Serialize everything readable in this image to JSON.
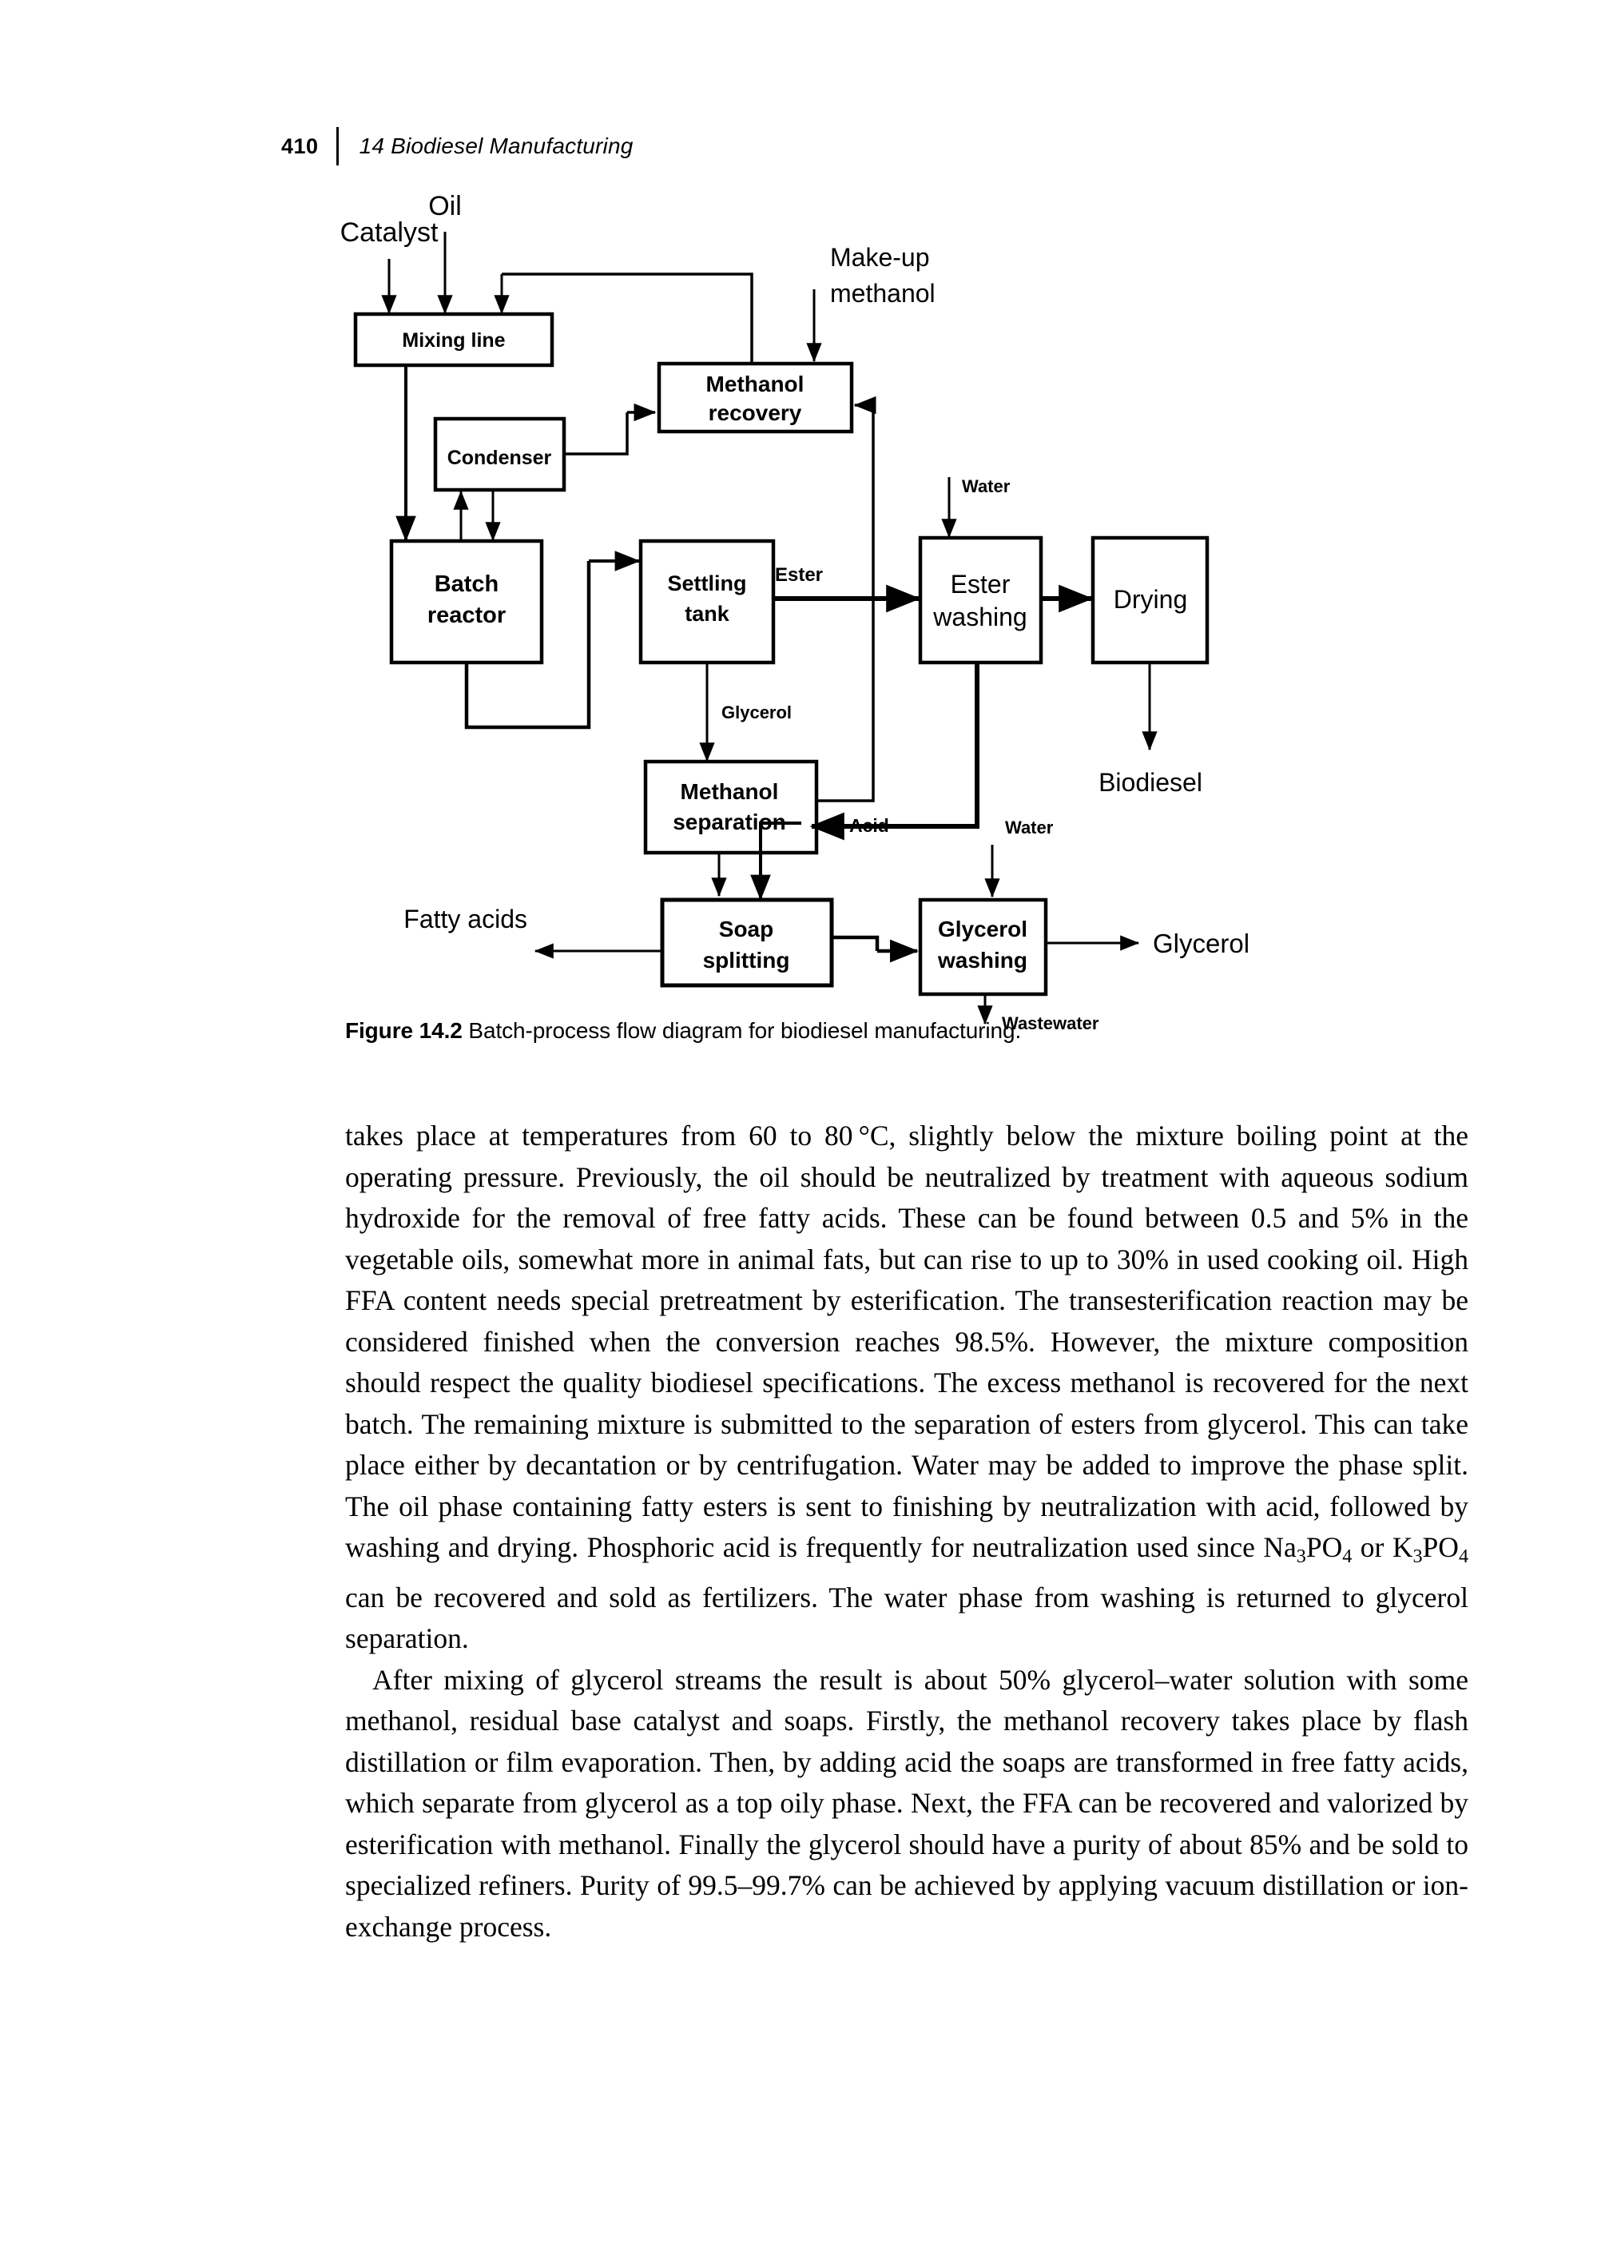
{
  "running_head": {
    "folio": "410",
    "chapter": "14  Biodiesel Manufacturing"
  },
  "figure": {
    "caption_lead": "Figure 14.2",
    "caption_text": "Batch-process flow diagram for biodiesel manufacturing.",
    "boxes": [
      {
        "id": "mixing-line",
        "label_line1": "Mixing line",
        "label_line2": ""
      },
      {
        "id": "methanol-recovery",
        "label_line1": "Methanol",
        "label_line2": "recovery"
      },
      {
        "id": "condenser",
        "label_line1": "Condenser",
        "label_line2": ""
      },
      {
        "id": "batch-reactor",
        "label_line1": "Batch",
        "label_line2": "reactor"
      },
      {
        "id": "settling-tank",
        "label_line1": "Settling",
        "label_line2": "tank"
      },
      {
        "id": "ester-washing",
        "label_line1": "Ester",
        "label_line2": "washing"
      },
      {
        "id": "drying",
        "label_line1": "Drying",
        "label_line2": ""
      },
      {
        "id": "methanol-separation",
        "label_line1": "Methanol",
        "label_line2": "separation"
      },
      {
        "id": "soap-splitting",
        "label_line1": "Soap",
        "label_line2": "splitting"
      },
      {
        "id": "glycerol-washing",
        "label_line1": "Glycerol",
        "label_line2": "washing"
      }
    ],
    "stream_labels": {
      "oil": "Oil",
      "catalyst": "Catalyst",
      "makeup_methanol_line1": "Make-up",
      "makeup_methanol_line2": "methanol",
      "water_top": "Water",
      "water_mid": "Water",
      "ester": "Ester",
      "glycerol_stream": "Glycerol",
      "acid": "Acid",
      "biodiesel": "Biodiesel",
      "fatty_acids": "Fatty acids",
      "glycerol_product": "Glycerol",
      "wastewater": "Wastewater"
    },
    "colors": {
      "line": "#000000",
      "box_fill": "#ffffff",
      "text": "#000000"
    }
  },
  "body": {
    "p1": "takes place at temperatures from 60 to 80 °C, slightly below the mixture boiling point at the operating pressure. Previously, the oil should be neutralized by treatment with aqueous sodium hydroxide for the removal of free fatty acids. These can be found between 0.5 and 5% in the vegetable oils, somewhat more in animal fats, but can rise to up to 30% in used cooking oil. High FFA content needs special pretreatment by esterification. The transesterification reaction may be considered finished when the conversion reaches 98.5%. However, the mixture composition should respect the quality biodiesel specifications. The excess methanol is recovered for the next batch. The remaining mixture is submitted to the separation of esters from glycerol. This can take place either by decantation or by centrifugation. Water may be added to improve the phase split. The oil phase containing fatty esters is sent to finishing by neutralization with acid, followed by washing and drying. Phosphoric acid is frequently for neutralization used since ",
    "p1_formula_a": "Na3PO4",
    "p1_mid": " or ",
    "p1_formula_b": "K3PO4",
    "p1_tail": " can be recovered and sold as fertilizers. The water phase from washing is returned to glycerol separation.",
    "p2": "After mixing of glycerol streams the result is about 50% glycerol–water solution with some methanol, residual base catalyst and soaps. Firstly, the methanol recovery takes place by flash distillation or film evaporation. Then, by adding acid the soaps are transformed in free fatty acids, which separate from glycerol as a top oily phase. Next, the FFA can be recovered and valorized by esterification with methanol. Finally the glycerol should have a purity of about 85% and be sold to specialized refiners. Purity of 99.5–99.7% can be achieved by applying vacuum distillation or ion-exchange process."
  }
}
